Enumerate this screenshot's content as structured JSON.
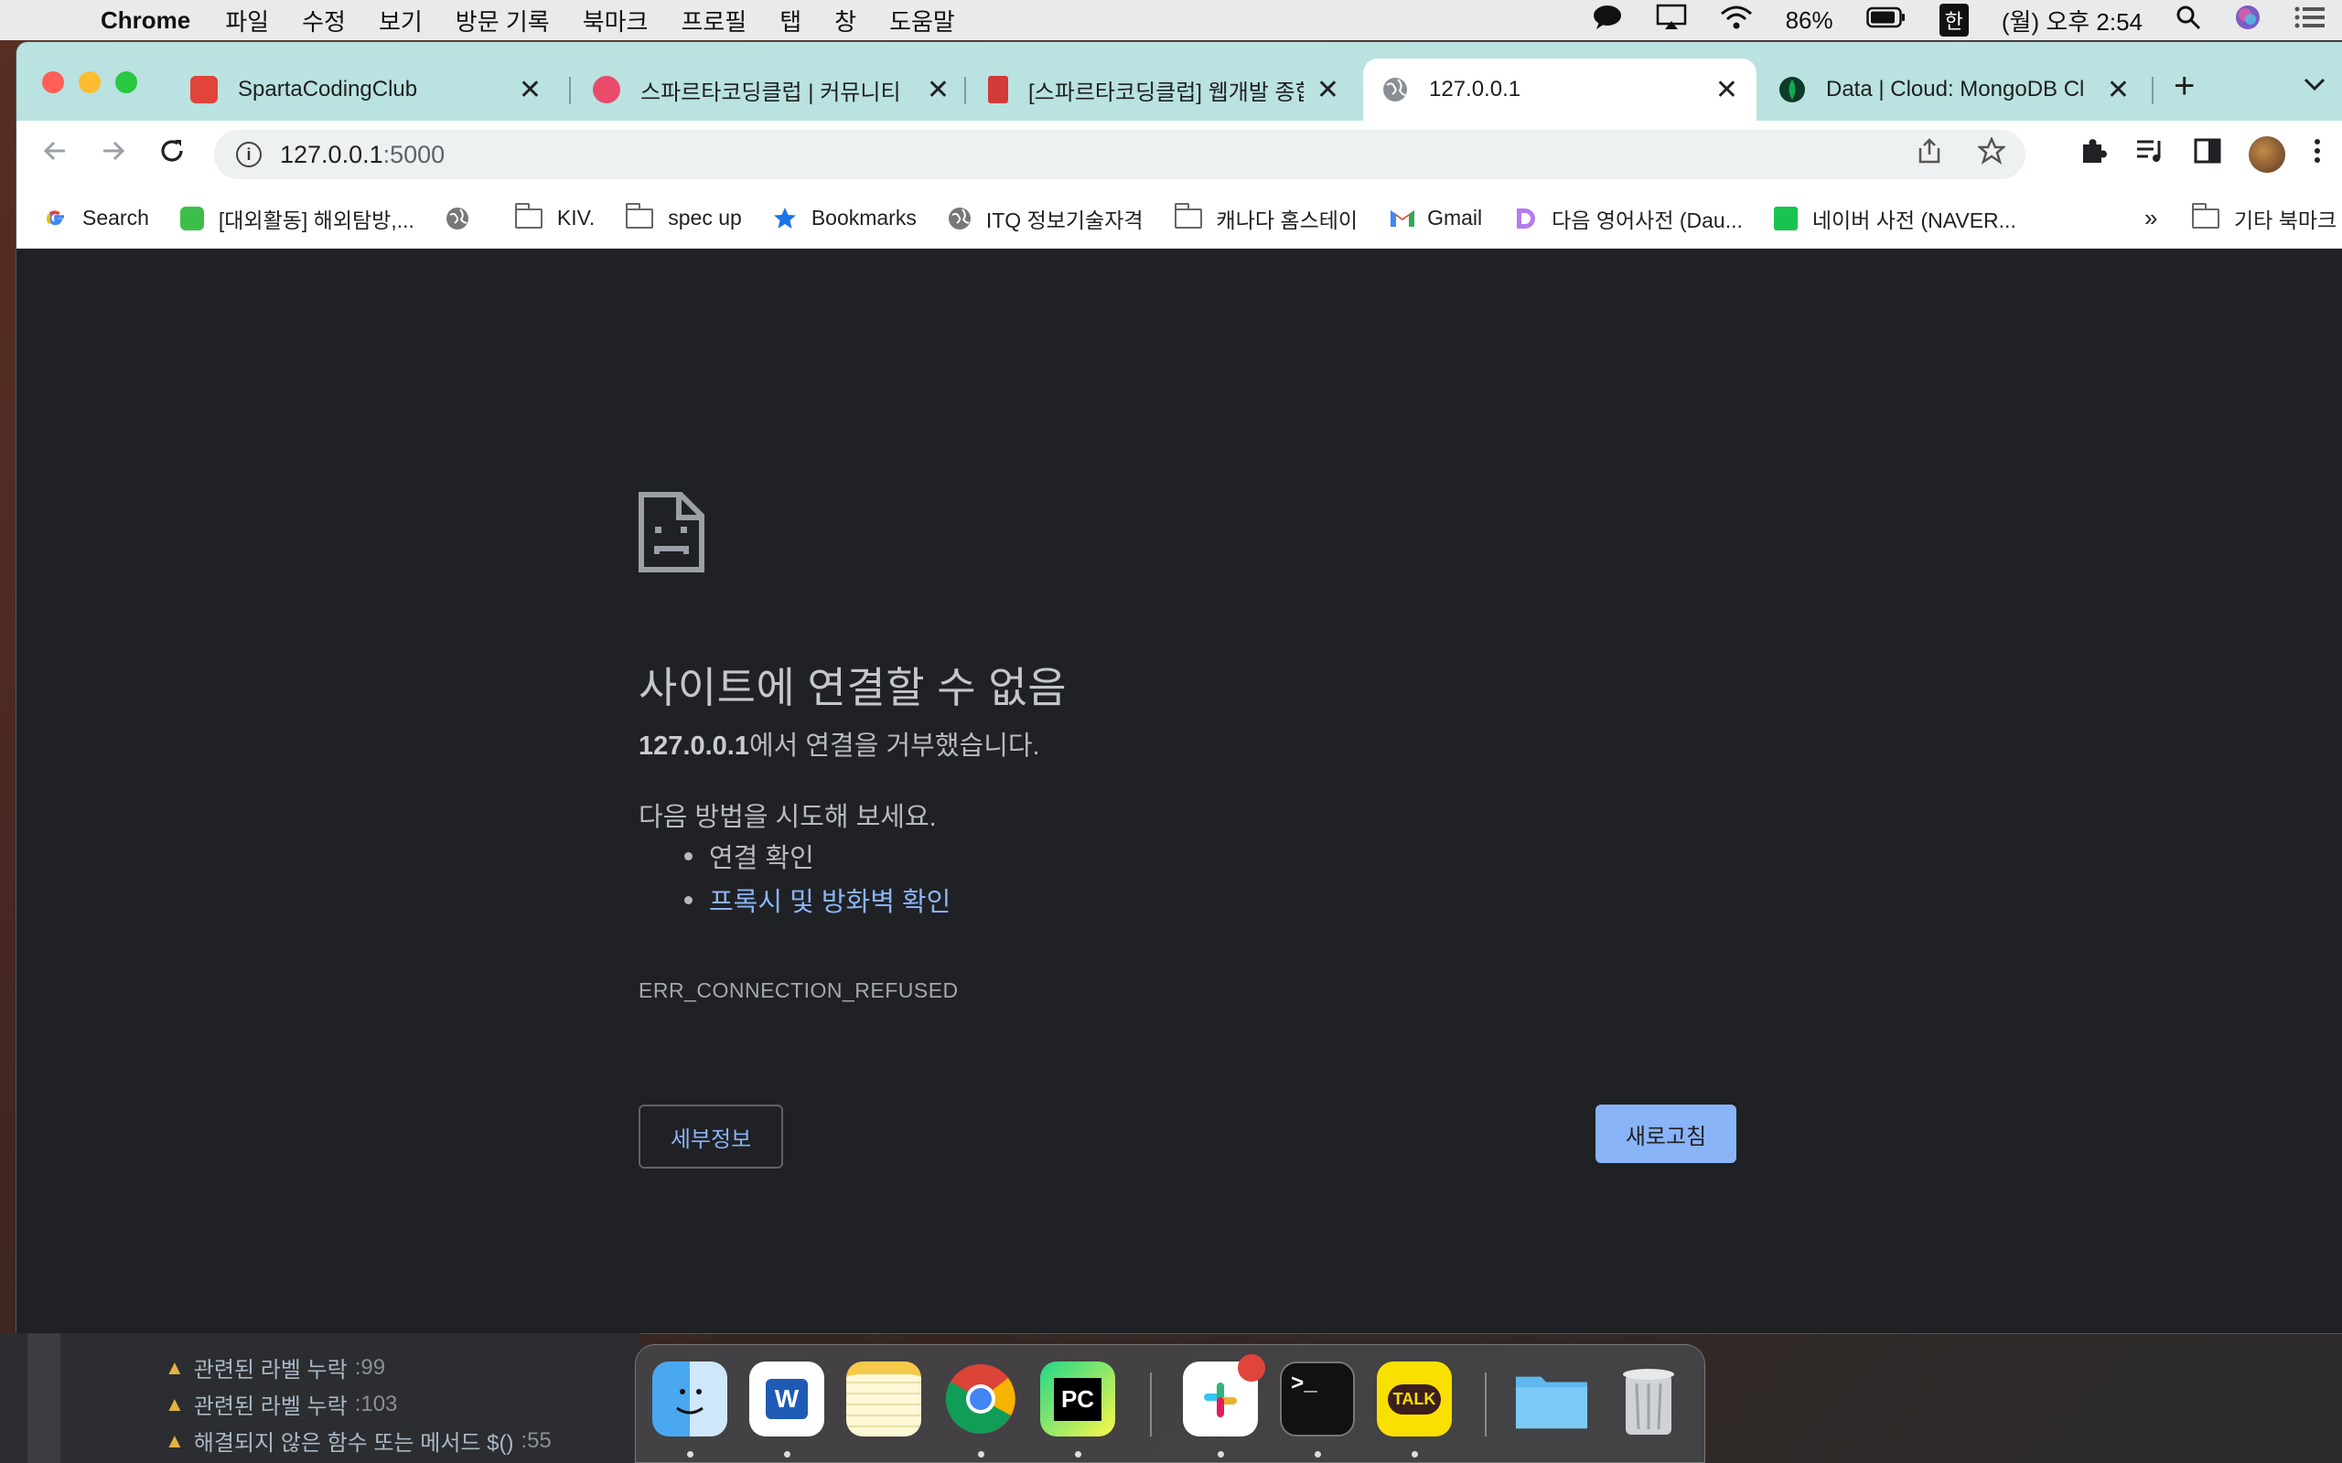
{
  "menubar": {
    "app": "Chrome",
    "items": [
      "파일",
      "수정",
      "보기",
      "방문 기록",
      "북마크",
      "프로필",
      "탭",
      "창",
      "도움말"
    ],
    "battery": "86%",
    "input_lang": "한",
    "clock": "(월) 오후 2:54"
  },
  "tabs": [
    {
      "title": "SpartaCodingClub",
      "color": "#e0443a"
    },
    {
      "title": "스파르타코딩클럽 | 커뮤니티",
      "color": "#ea4b6b"
    },
    {
      "title": "[스파르타코딩클럽] 웹개발 종합",
      "color": "#d33a3a"
    },
    {
      "title": "127.0.0.1",
      "color": "#8a8f96"
    },
    {
      "title": "Data | Cloud: MongoDB Cl",
      "color": "#13aa52"
    }
  ],
  "address": {
    "host": "127.0.0.1",
    "port": ":5000"
  },
  "bookmarks": [
    {
      "label": "Search"
    },
    {
      "label": "[대외활동] 해외탐방,..."
    },
    {
      "label": ""
    },
    {
      "label": "KIV."
    },
    {
      "label": "spec up"
    },
    {
      "label": "Bookmarks"
    },
    {
      "label": "ITQ 정보기술자격"
    },
    {
      "label": "캐나다 홈스테이"
    },
    {
      "label": "Gmail"
    },
    {
      "label": "다음 영어사전 (Dau..."
    },
    {
      "label": "네이버 사전 (NAVER..."
    }
  ],
  "bookmarks_more": "»",
  "bookmarks_other": "기타 북마크",
  "error": {
    "title": "사이트에 연결할 수 없음",
    "host": "127.0.0.1",
    "refused_suffix": "에서 연결을 거부했습니다.",
    "try_heading": "다음 방법을 시도해 보세요.",
    "suggestions": [
      "연결 확인",
      "프록시 및 방화벽 확인"
    ],
    "code": "ERR_CONNECTION_REFUSED",
    "details_label": "세부정보",
    "reload_label": "새로고침"
  },
  "ide": {
    "lines": [
      {
        "text": "관련된 라벨 누락",
        "line": ":99"
      },
      {
        "text": "관련된 라벨 누락",
        "line": ":103"
      },
      {
        "text": "해결되지 않은 함수 또는 메서드 $()",
        "line": ":55"
      }
    ]
  },
  "dock": {
    "terminal_label": ">_",
    "pycharm_label": "PC",
    "word_label": "W",
    "talk_label": "TALK"
  }
}
